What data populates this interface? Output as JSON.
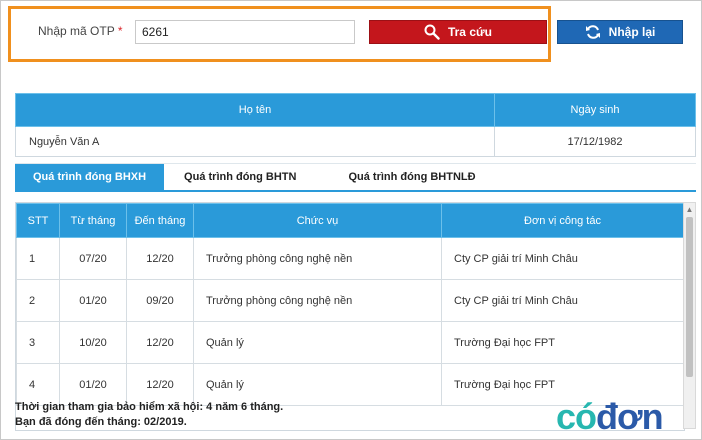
{
  "otp": {
    "label": "Nhập mã OTP",
    "required_mark": "*",
    "value": "6261",
    "search_label": "Tra cứu",
    "reset_label": "Nhập lại"
  },
  "person": {
    "headers": [
      "Họ tên",
      "Ngày sinh"
    ],
    "name": "Nguyễn Văn A",
    "dob": "17/12/1982"
  },
  "tabs": [
    {
      "label": "Quá trình đóng BHXH",
      "active": true
    },
    {
      "label": "Quá trình đóng BHTN",
      "active": false
    },
    {
      "label": "Quá trình đóng BHTNLĐ",
      "active": false
    }
  ],
  "history": {
    "headers": [
      "STT",
      "Từ tháng",
      "Đến tháng",
      "Chức vụ",
      "Đơn vị công tác"
    ],
    "rows": [
      [
        "1",
        "07/20",
        "12/20",
        "Trưởng phòng công nghệ nền",
        "Cty CP giải trí Minh Châu"
      ],
      [
        "2",
        "01/20",
        "09/20",
        "Trưởng phòng công nghệ nền",
        "Cty CP giải trí Minh Châu"
      ],
      [
        "3",
        "10/20",
        "12/20",
        "Quản lý",
        "Trường Đại học FPT"
      ],
      [
        "4",
        "01/20",
        "12/20",
        "Quản lý",
        "Trường Đại học FPT"
      ]
    ]
  },
  "summary": {
    "line1": "Thời gian tham gia bảo hiểm xã hội: 4 năm 6 tháng.",
    "line2": "Bạn đã đóng đến tháng: 02/2019."
  },
  "logo": {
    "part1": "có",
    "part2": "đơn"
  },
  "colors": {
    "accent": "#2a9ad9",
    "search": "#c4161c",
    "reset": "#1f68b5",
    "highlight": "#f0901e"
  }
}
